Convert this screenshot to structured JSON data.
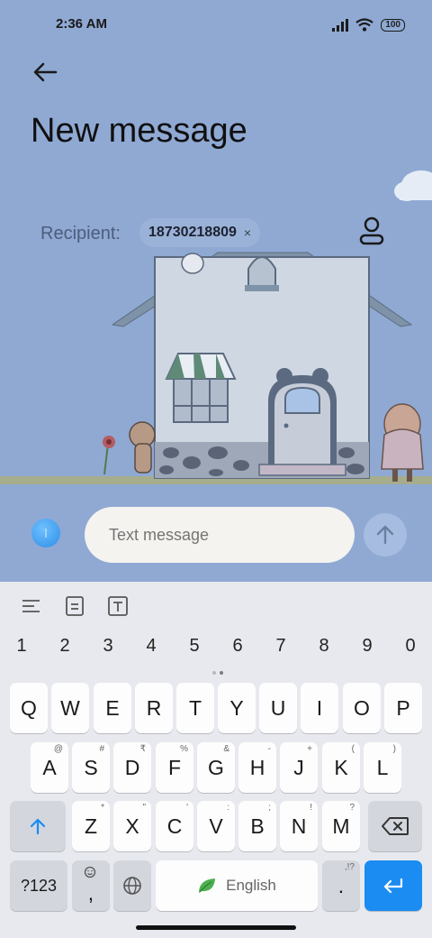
{
  "status": {
    "time": "2:36 AM",
    "battery": "100"
  },
  "page": {
    "title": "New message"
  },
  "recipient": {
    "label": "Recipient:",
    "chip": "18730218809",
    "chip_close": "×"
  },
  "composer": {
    "placeholder": "Text message"
  },
  "keyboard": {
    "numbers": [
      "1",
      "2",
      "3",
      "4",
      "5",
      "6",
      "7",
      "8",
      "9",
      "0"
    ],
    "row1": [
      "Q",
      "W",
      "E",
      "R",
      "T",
      "Y",
      "U",
      "I",
      "O",
      "P"
    ],
    "row2": [
      "A",
      "S",
      "D",
      "F",
      "G",
      "H",
      "J",
      "K",
      "L"
    ],
    "row2_hints": [
      "@",
      "#",
      "₹",
      "%",
      "&",
      "-",
      "+",
      "(",
      ")"
    ],
    "row3": [
      "Z",
      "X",
      "C",
      "V",
      "B",
      "N",
      "M"
    ],
    "row3_hints": [
      "*",
      "\"",
      "'",
      ":",
      ";",
      "!",
      "?"
    ],
    "symbols_label": "?123",
    "comma": ",",
    "space_label": "English",
    "period": ".",
    "period_hint": ",!?"
  },
  "colors": {
    "background": "#8fa9d3",
    "accent": "#1a8cf2"
  }
}
